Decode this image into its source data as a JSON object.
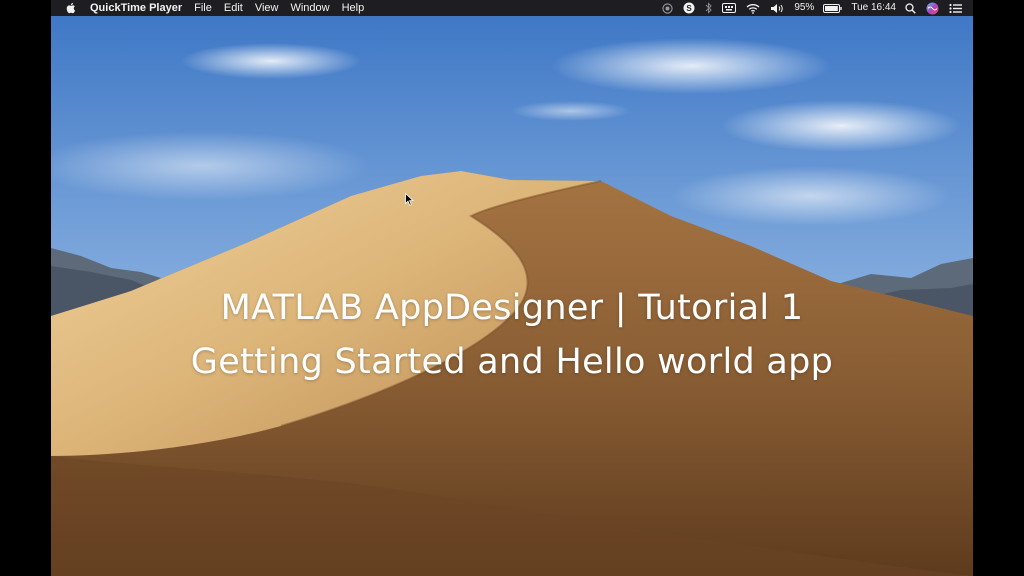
{
  "menubar": {
    "apple_icon": "apple-logo-icon",
    "app_name": "QuickTime Player",
    "menus": [
      "File",
      "Edit",
      "View",
      "Window",
      "Help"
    ],
    "status": {
      "battery_percent": "95%",
      "clock": "Tue 16:44",
      "icons": [
        "screen-record-icon",
        "skype-icon",
        "bluetooth-icon",
        "keyboard-input-icon",
        "wifi-icon",
        "volume-icon",
        "battery-icon",
        "spotlight-search-icon",
        "siri-icon",
        "notification-center-icon"
      ]
    }
  },
  "video": {
    "title_line1": "MATLAB AppDesigner | Tutorial 1",
    "title_line2": "Getting Started and Hello world app"
  },
  "colors": {
    "menubar_bg": "#1e1e22",
    "sky_top": "#3f78c6",
    "sky_bottom": "#b8d2ec",
    "dune_light": "#e6c38a",
    "dune_shadow": "#8a5e34"
  }
}
